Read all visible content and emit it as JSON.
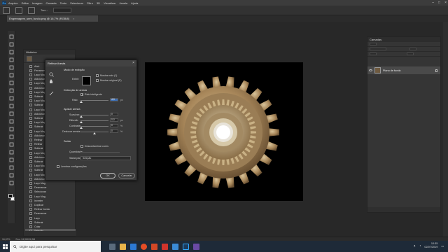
{
  "menubar": {
    "app": "Ps",
    "items": [
      "Arquivo",
      "Editar",
      "Imagem",
      "Camada",
      "Texto",
      "Selecionar",
      "Filtro",
      "3D",
      "Visualizar",
      "Janela",
      "Ajuda"
    ]
  },
  "document_tab": {
    "title": "Engrenagem_sem_fundo.png @ 16,7% (RGB/8)",
    "close": "×"
  },
  "options_bar": {
    "size_label": "Tam.:"
  },
  "history_panel": {
    "title": "Histórico",
    "rows": [
      "Abrir",
      "Ferramenta",
      "Laço Mag.",
      "Adicionar",
      "Laço Mag.",
      "Adicionar",
      "Laço Mag.",
      "Subtrair",
      "Laço Mag.",
      "Subtrair",
      "Laço Mag.",
      "Adicionar",
      "Subtrair",
      "Laço Mag.",
      "Subtrair",
      "Laço Mag.",
      "Adicionar",
      "Refinar",
      "Refinar",
      "Subtrair",
      "Laço Mag.",
      "Adicionar",
      "Subtrair",
      "Laço Mag.",
      "Subtrair",
      "Laço Mag.",
      "Adicionar",
      "Laço Mag.",
      "Desmarcar",
      "Selecionar",
      "Laço Mag.",
      "Inverter",
      "Duplicar",
      "Refinar borda",
      "Desmarcar",
      "Laço",
      "Subtrair",
      "Colar",
      "Seleção"
    ]
  },
  "dialog": {
    "title": "Refinar Aresta",
    "close": "×",
    "view_mode_heading": "Modo de exibição",
    "view_label": "Exibir:",
    "show_radius": "Mostrar raio (J)",
    "show_original": "Mostrar original (P)",
    "edge_detection_heading": "Detecção de aresta",
    "smart_radius": "Raio inteligente",
    "radius_label": "Raio:",
    "radius_value": "4,0",
    "radius_unit": "px",
    "adjust_edge_heading": "Ajustar aresta",
    "smooth_label": "Suavizar:",
    "smooth_value": "0",
    "feather_label": "Difundir:",
    "feather_value": "0,0",
    "feather_unit": "px",
    "contrast_label": "Contraste:",
    "contrast_value": "0",
    "contrast_unit": "%",
    "shift_label": "Deslocar aresta:",
    "shift_value": "0",
    "shift_unit": "%",
    "output_heading": "Saída",
    "decontaminate": "Descontaminar cores",
    "amount_label": "Quantidade:",
    "output_to_label": "Saída para:",
    "output_to_value": "Seleção",
    "remember": "Lembrar configurações",
    "ok": "OK",
    "cancel": "Cancelar"
  },
  "layers_panel": {
    "title": "Camadas",
    "layer_name": "Plano de fundo"
  },
  "status_bar": {
    "zoom": "16,67%",
    "doc": "Doc: 24,9M/24,9M"
  },
  "taskbar": {
    "search_placeholder": "Digite aqui para pesquisar",
    "time": "10:35",
    "date": "02/07/2019"
  },
  "colors": {
    "accent": "#31a8ff",
    "panel": "#353535",
    "canvas": "#000000",
    "gear": "#b8a078"
  }
}
